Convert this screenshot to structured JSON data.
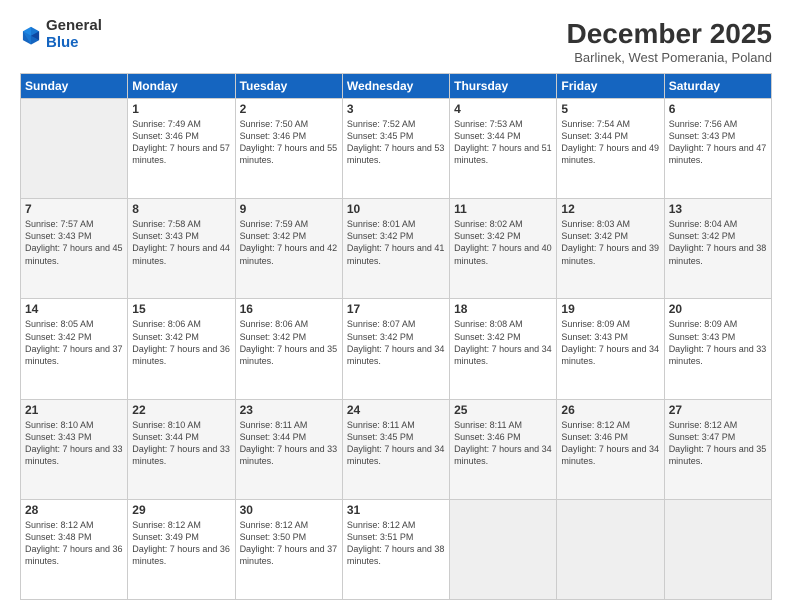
{
  "header": {
    "logo_general": "General",
    "logo_blue": "Blue",
    "month_title": "December 2025",
    "subtitle": "Barlinek, West Pomerania, Poland"
  },
  "weekdays": [
    "Sunday",
    "Monday",
    "Tuesday",
    "Wednesday",
    "Thursday",
    "Friday",
    "Saturday"
  ],
  "weeks": [
    [
      {
        "day": "",
        "sunrise": "",
        "sunset": "",
        "daylight": "",
        "empty": true
      },
      {
        "day": "1",
        "sunrise": "Sunrise: 7:49 AM",
        "sunset": "Sunset: 3:46 PM",
        "daylight": "Daylight: 7 hours and 57 minutes."
      },
      {
        "day": "2",
        "sunrise": "Sunrise: 7:50 AM",
        "sunset": "Sunset: 3:46 PM",
        "daylight": "Daylight: 7 hours and 55 minutes."
      },
      {
        "day": "3",
        "sunrise": "Sunrise: 7:52 AM",
        "sunset": "Sunset: 3:45 PM",
        "daylight": "Daylight: 7 hours and 53 minutes."
      },
      {
        "day": "4",
        "sunrise": "Sunrise: 7:53 AM",
        "sunset": "Sunset: 3:44 PM",
        "daylight": "Daylight: 7 hours and 51 minutes."
      },
      {
        "day": "5",
        "sunrise": "Sunrise: 7:54 AM",
        "sunset": "Sunset: 3:44 PM",
        "daylight": "Daylight: 7 hours and 49 minutes."
      },
      {
        "day": "6",
        "sunrise": "Sunrise: 7:56 AM",
        "sunset": "Sunset: 3:43 PM",
        "daylight": "Daylight: 7 hours and 47 minutes."
      }
    ],
    [
      {
        "day": "7",
        "sunrise": "Sunrise: 7:57 AM",
        "sunset": "Sunset: 3:43 PM",
        "daylight": "Daylight: 7 hours and 45 minutes."
      },
      {
        "day": "8",
        "sunrise": "Sunrise: 7:58 AM",
        "sunset": "Sunset: 3:43 PM",
        "daylight": "Daylight: 7 hours and 44 minutes."
      },
      {
        "day": "9",
        "sunrise": "Sunrise: 7:59 AM",
        "sunset": "Sunset: 3:42 PM",
        "daylight": "Daylight: 7 hours and 42 minutes."
      },
      {
        "day": "10",
        "sunrise": "Sunrise: 8:01 AM",
        "sunset": "Sunset: 3:42 PM",
        "daylight": "Daylight: 7 hours and 41 minutes."
      },
      {
        "day": "11",
        "sunrise": "Sunrise: 8:02 AM",
        "sunset": "Sunset: 3:42 PM",
        "daylight": "Daylight: 7 hours and 40 minutes."
      },
      {
        "day": "12",
        "sunrise": "Sunrise: 8:03 AM",
        "sunset": "Sunset: 3:42 PM",
        "daylight": "Daylight: 7 hours and 39 minutes."
      },
      {
        "day": "13",
        "sunrise": "Sunrise: 8:04 AM",
        "sunset": "Sunset: 3:42 PM",
        "daylight": "Daylight: 7 hours and 38 minutes."
      }
    ],
    [
      {
        "day": "14",
        "sunrise": "Sunrise: 8:05 AM",
        "sunset": "Sunset: 3:42 PM",
        "daylight": "Daylight: 7 hours and 37 minutes."
      },
      {
        "day": "15",
        "sunrise": "Sunrise: 8:06 AM",
        "sunset": "Sunset: 3:42 PM",
        "daylight": "Daylight: 7 hours and 36 minutes."
      },
      {
        "day": "16",
        "sunrise": "Sunrise: 8:06 AM",
        "sunset": "Sunset: 3:42 PM",
        "daylight": "Daylight: 7 hours and 35 minutes."
      },
      {
        "day": "17",
        "sunrise": "Sunrise: 8:07 AM",
        "sunset": "Sunset: 3:42 PM",
        "daylight": "Daylight: 7 hours and 34 minutes."
      },
      {
        "day": "18",
        "sunrise": "Sunrise: 8:08 AM",
        "sunset": "Sunset: 3:42 PM",
        "daylight": "Daylight: 7 hours and 34 minutes."
      },
      {
        "day": "19",
        "sunrise": "Sunrise: 8:09 AM",
        "sunset": "Sunset: 3:43 PM",
        "daylight": "Daylight: 7 hours and 34 minutes."
      },
      {
        "day": "20",
        "sunrise": "Sunrise: 8:09 AM",
        "sunset": "Sunset: 3:43 PM",
        "daylight": "Daylight: 7 hours and 33 minutes."
      }
    ],
    [
      {
        "day": "21",
        "sunrise": "Sunrise: 8:10 AM",
        "sunset": "Sunset: 3:43 PM",
        "daylight": "Daylight: 7 hours and 33 minutes."
      },
      {
        "day": "22",
        "sunrise": "Sunrise: 8:10 AM",
        "sunset": "Sunset: 3:44 PM",
        "daylight": "Daylight: 7 hours and 33 minutes."
      },
      {
        "day": "23",
        "sunrise": "Sunrise: 8:11 AM",
        "sunset": "Sunset: 3:44 PM",
        "daylight": "Daylight: 7 hours and 33 minutes."
      },
      {
        "day": "24",
        "sunrise": "Sunrise: 8:11 AM",
        "sunset": "Sunset: 3:45 PM",
        "daylight": "Daylight: 7 hours and 34 minutes."
      },
      {
        "day": "25",
        "sunrise": "Sunrise: 8:11 AM",
        "sunset": "Sunset: 3:46 PM",
        "daylight": "Daylight: 7 hours and 34 minutes."
      },
      {
        "day": "26",
        "sunrise": "Sunrise: 8:12 AM",
        "sunset": "Sunset: 3:46 PM",
        "daylight": "Daylight: 7 hours and 34 minutes."
      },
      {
        "day": "27",
        "sunrise": "Sunrise: 8:12 AM",
        "sunset": "Sunset: 3:47 PM",
        "daylight": "Daylight: 7 hours and 35 minutes."
      }
    ],
    [
      {
        "day": "28",
        "sunrise": "Sunrise: 8:12 AM",
        "sunset": "Sunset: 3:48 PM",
        "daylight": "Daylight: 7 hours and 36 minutes."
      },
      {
        "day": "29",
        "sunrise": "Sunrise: 8:12 AM",
        "sunset": "Sunset: 3:49 PM",
        "daylight": "Daylight: 7 hours and 36 minutes."
      },
      {
        "day": "30",
        "sunrise": "Sunrise: 8:12 AM",
        "sunset": "Sunset: 3:50 PM",
        "daylight": "Daylight: 7 hours and 37 minutes."
      },
      {
        "day": "31",
        "sunrise": "Sunrise: 8:12 AM",
        "sunset": "Sunset: 3:51 PM",
        "daylight": "Daylight: 7 hours and 38 minutes."
      },
      {
        "day": "",
        "sunrise": "",
        "sunset": "",
        "daylight": "",
        "empty": true
      },
      {
        "day": "",
        "sunrise": "",
        "sunset": "",
        "daylight": "",
        "empty": true
      },
      {
        "day": "",
        "sunrise": "",
        "sunset": "",
        "daylight": "",
        "empty": true
      }
    ]
  ]
}
